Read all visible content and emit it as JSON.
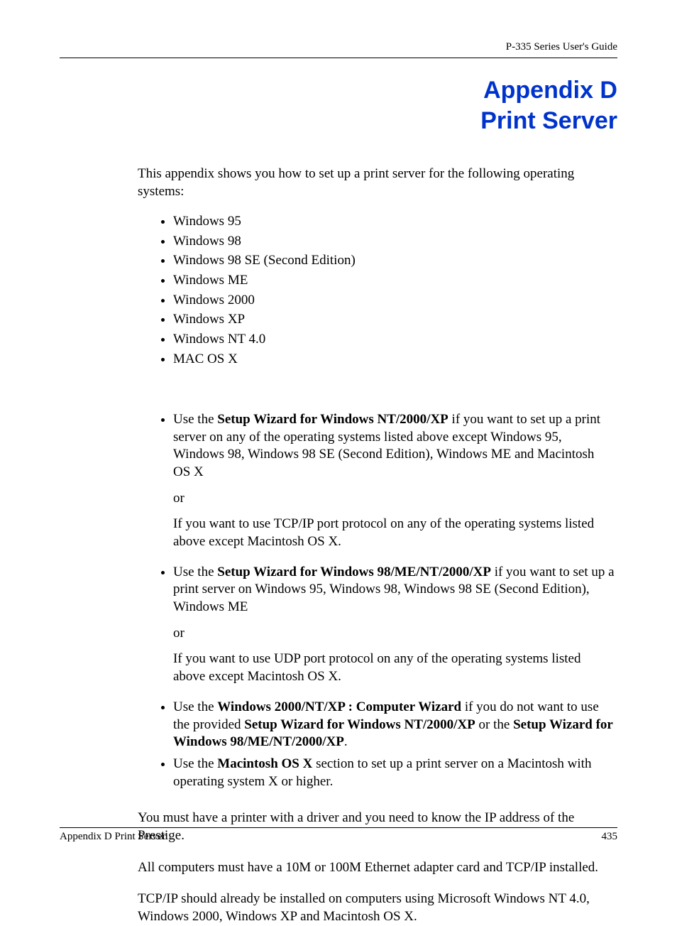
{
  "header": {
    "guide_title": "P-335 Series User's Guide"
  },
  "title": {
    "line1": "Appendix D",
    "line2": "Print Server"
  },
  "intro": "This appendix shows you how to set up a print server for the following operating systems:",
  "os_list": [
    "Windows 95",
    "Windows 98",
    "Windows 98 SE (Second Edition)",
    "Windows ME",
    "Windows 2000",
    "Windows XP",
    "Windows NT 4.0",
    "MAC OS X"
  ],
  "wizards": {
    "item1": {
      "prefix": "Use the ",
      "bold1": "Setup Wizard for Windows NT/2000/XP",
      "rest": " if you want to set up a print server on any of the operating systems listed above except Windows 95, Windows 98, Windows 98 SE (Second Edition), Windows ME and Macintosh OS X",
      "or": "or",
      "sub": "If you want to use TCP/IP port protocol on any of the operating systems listed above except Macintosh OS X."
    },
    "item2": {
      "prefix": "Use the ",
      "bold1": "Setup Wizard for Windows 98/ME/NT/2000/XP",
      "rest": " if you want to set up a print server on Windows 95, Windows 98, Windows 98 SE (Second Edition), Windows ME",
      "or": "or",
      "sub": "If you want to use UDP port protocol on any of the operating systems listed above except Macintosh OS X."
    },
    "item3": {
      "prefix": "Use the ",
      "bold1": "Windows 2000/NT/XP : Computer Wizard",
      "mid1": " if you do not want to use the provided ",
      "bold2": "Setup Wizard for Windows NT/2000/XP",
      "mid2": " or the ",
      "bold3": "Setup Wizard for Windows 98/ME/NT/2000/XP",
      "end": "."
    },
    "item4": {
      "prefix": "Use the ",
      "bold1": "Macintosh OS X",
      "rest": " section to set up a print server on a Macintosh with operating system X or higher."
    }
  },
  "closing": {
    "p1": "You must have a printer with a driver and you need to know the IP address of the Prestige.",
    "p2": "All computers must have a 10M or 100M Ethernet adapter card and TCP/IP installed.",
    "p3": "TCP/IP should already be installed on computers using Microsoft Windows NT 4.0, Windows 2000, Windows XP and Macintosh OS X."
  },
  "footer": {
    "left": "Appendix D Print Server",
    "right": "435"
  }
}
